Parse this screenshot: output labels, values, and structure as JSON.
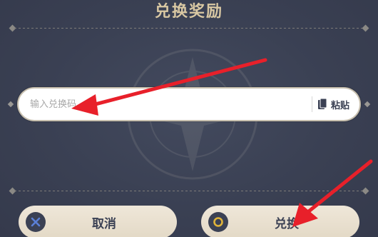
{
  "dialog": {
    "title": "兑换奖励"
  },
  "redeem_input": {
    "placeholder": "输入兑换码",
    "value": ""
  },
  "paste": {
    "label": "粘贴",
    "icon": "clipboard-icon"
  },
  "buttons": {
    "cancel_label": "取消",
    "cancel_icon": "x-circle-icon",
    "confirm_label": "兑换",
    "confirm_icon": "o-circle-icon"
  },
  "colors": {
    "background": "#3b4154",
    "title": "#d9c8a3",
    "button_bg": "#ece3d3",
    "cancel_icon_accent": "#5b7fd6",
    "confirm_icon_accent": "#e0b43a",
    "annotation_arrow": "#e8202a"
  }
}
